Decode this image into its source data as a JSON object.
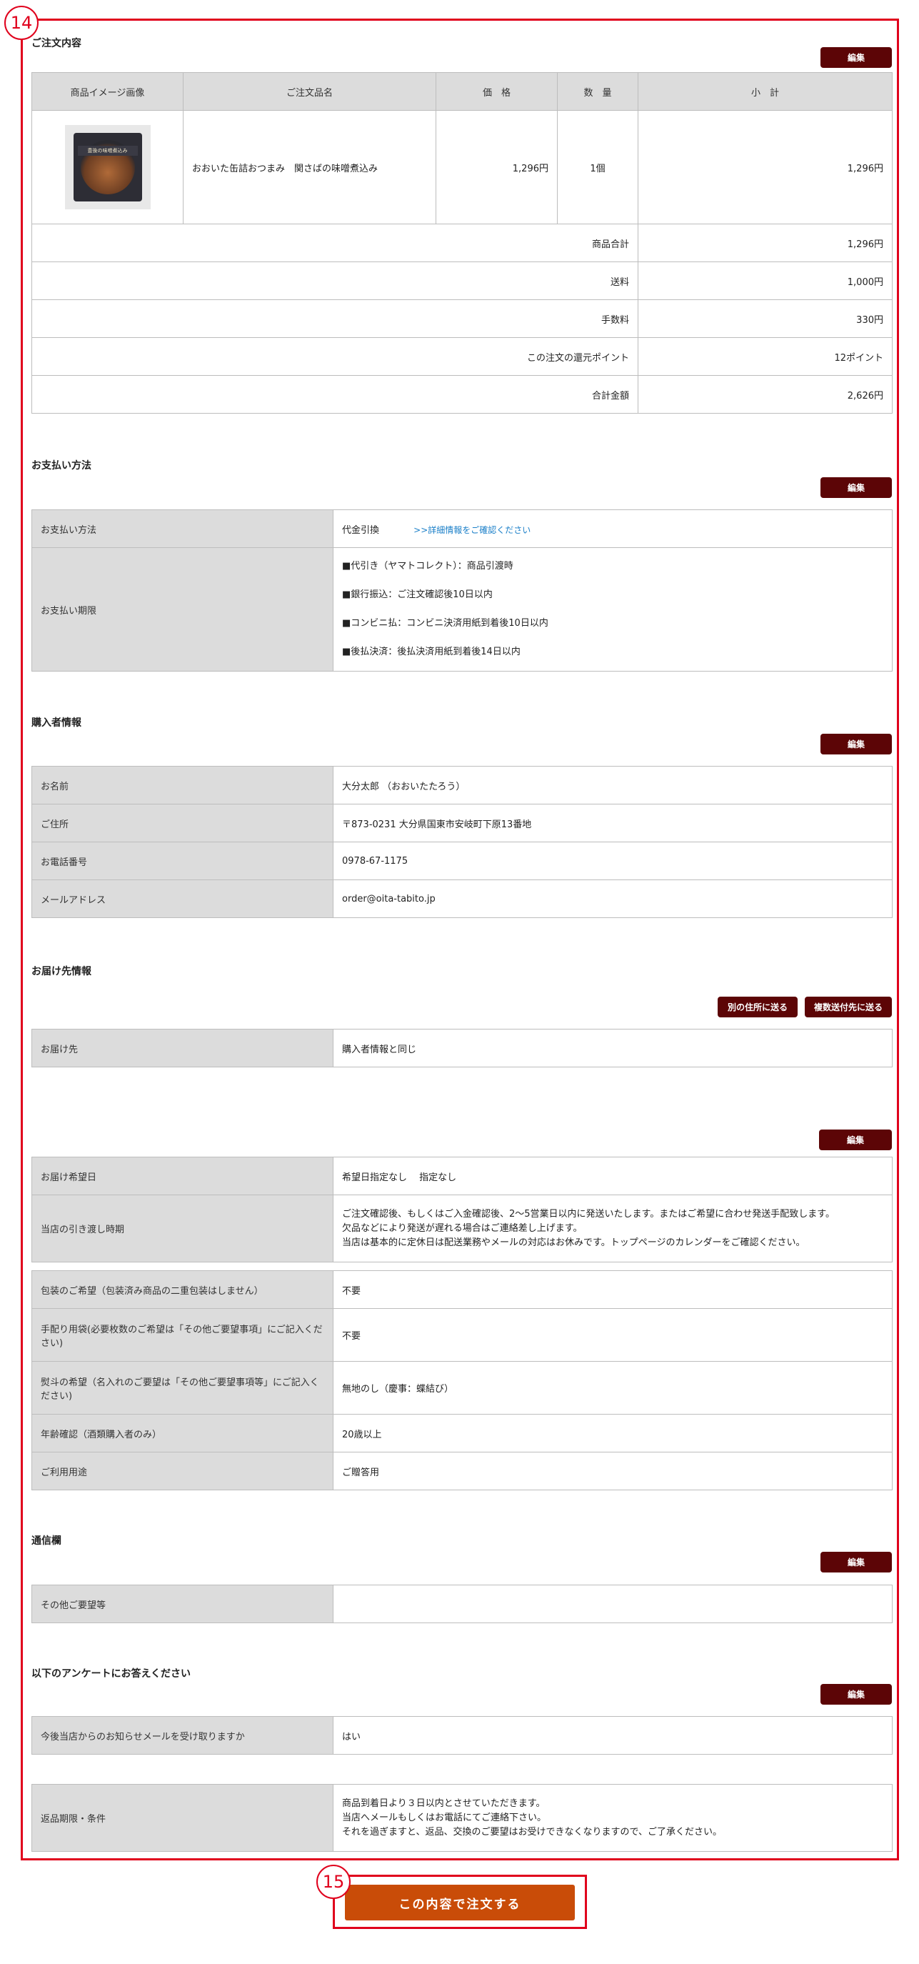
{
  "markers": {
    "m14": "14",
    "m15": "15"
  },
  "order": {
    "title": "ご注文内容",
    "edit_label": "編集",
    "headers": [
      "商品イメージ画像",
      "ご注文品名",
      "価　格",
      "数　量",
      "小　計"
    ],
    "item": {
      "image_label": "豊後の味噌煮込み",
      "name": "おおいた缶詰おつまみ　関さばの味噌煮込み",
      "price": "1,296円",
      "qty": "1個",
      "subtotal": "1,296円"
    },
    "summary": [
      {
        "label": "商品合計",
        "value": "1,296円"
      },
      {
        "label": "送料",
        "value": "1,000円"
      },
      {
        "label": "手数料",
        "value": "330円"
      },
      {
        "label": "この注文の還元ポイント",
        "value": "12ポイント"
      },
      {
        "label": "合計金額",
        "value": "2,626円"
      }
    ]
  },
  "payment": {
    "title": "お支払い方法",
    "edit_label": "編集",
    "method_label": "お支払い方法",
    "method_value": "代金引換",
    "detail_link": ">>詳細情報をご確認ください",
    "deadline_label": "お支払い期限",
    "deadlines": [
      "■代引き（ヤマトコレクト）：商品引渡時",
      "■銀行振込：ご注文確認後10日以内",
      "■コンビニ払：コンビニ決済用紙到着後10日以内",
      "■後払決済：後払決済用紙到着後14日以内"
    ]
  },
  "buyer": {
    "title": "購入者情報",
    "edit_label": "編集",
    "rows": [
      {
        "label": "お名前",
        "value": "大分太郎 （おおいたたろう）"
      },
      {
        "label": "ご住所",
        "value": "〒873-0231  大分県国東市安岐町下原13番地"
      },
      {
        "label": "お電話番号",
        "value": "0978-67-1175"
      },
      {
        "label": "メールアドレス",
        "value": "order@oita-tabito.jp"
      }
    ]
  },
  "delivery": {
    "title": "お届け先情報",
    "other_address_label": "別の住所に送る",
    "multi_address_label": "複数送付先に送る",
    "dest_label": "お届け先",
    "dest_value": "購入者情報と同じ"
  },
  "options": {
    "edit_label": "編集",
    "date_label": "お届け希望日",
    "date_value": "希望日指定なし　 指定なし",
    "ship_label": "当店の引き渡し時期",
    "ship_lines": [
      "ご注文確認後、もしくはご入金確認後、2〜5営業日以内に発送いたします。またはご希望に合わせ発送手配致します。",
      "欠品などにより発送が遅れる場合はご連絡差し上げます。",
      "当店は基本的に定休日は配送業務やメールの対応はお休みです。トップページのカレンダーをご確認ください。"
    ],
    "rows": [
      {
        "label": "包装のご希望（包装済み商品の二重包装はしません）",
        "value": "不要"
      },
      {
        "label": "手配り用袋(必要枚数のご希望は「その他ご要望事項」にご記入ください)",
        "value": "不要"
      },
      {
        "label": "熨斗の希望（名入れのご要望は「その他ご要望事項等」にご記入ください)",
        "value": "無地のし（慶事：蝶結び）"
      },
      {
        "label": "年齢確認（酒類購入者のみ）",
        "value": "20歳以上"
      },
      {
        "label": "ご利用用途",
        "value": "ご贈答用"
      }
    ]
  },
  "message": {
    "title": "通信欄",
    "edit_label": "編集",
    "label": "その他ご要望等",
    "value": ""
  },
  "survey": {
    "title": "以下のアンケートにお答えください",
    "edit_label": "編集",
    "q_label": "今後当店からのお知らせメールを受け取りますか",
    "q_value": "はい",
    "return_label": "返品期限・条件",
    "return_lines": [
      "商品到着日より３日以内とさせていただきます。",
      "当店へメールもしくはお電話にてご連絡下さい。",
      "それを過ぎますと、返品、交換のご要望はお受けできなくなりますので、ご了承ください。"
    ]
  },
  "submit_label": "この内容で注文する"
}
